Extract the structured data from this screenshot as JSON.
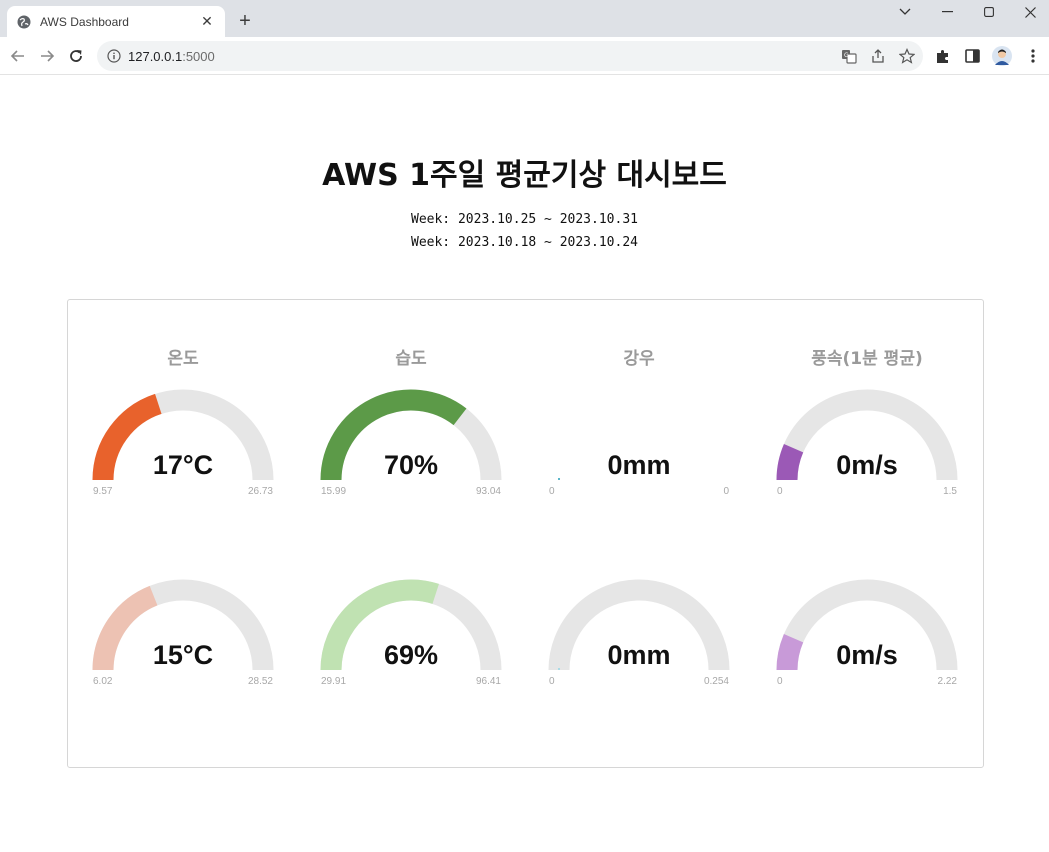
{
  "browser": {
    "tab_title": "AWS Dashboard",
    "url_host": "127.0.0.1",
    "url_rest": ":5000"
  },
  "page": {
    "title": "AWS 1주일 평균기상 대시보드",
    "weeks": [
      "Week: 2023.10.25 ~ 2023.10.31",
      "Week: 2023.10.18 ~ 2023.10.24"
    ]
  },
  "labels": [
    "온도",
    "습도",
    "강우",
    "풍속(1분 평균)"
  ],
  "gauges": [
    {
      "id": "temp-current",
      "row": 0,
      "col": 0,
      "value": "17°C",
      "num": 17,
      "min": "9.57",
      "max": "26.73",
      "minv": 9.57,
      "maxv": 26.73,
      "color": "#e8622c",
      "pct": 0.4
    },
    {
      "id": "humidity-current",
      "row": 0,
      "col": 1,
      "value": "70%",
      "num": 70,
      "min": "15.99",
      "max": "93.04",
      "minv": 15.99,
      "maxv": 93.04,
      "color": "#5c9a48",
      "pct": 0.71
    },
    {
      "id": "rain-current",
      "row": 0,
      "col": 2,
      "value": "0mm",
      "num": 0,
      "min": "0",
      "max": "0",
      "minv": 0,
      "maxv": 0,
      "color": "#59b6c9",
      "pct": 0.0,
      "no_track": true
    },
    {
      "id": "wind-current",
      "row": 0,
      "col": 3,
      "value": "0m/s",
      "num": 0,
      "min": "0",
      "max": "1.5",
      "minv": 0,
      "maxv": 1.5,
      "color": "#9b59b6",
      "pct": 0.13
    },
    {
      "id": "temp-previous",
      "row": 1,
      "col": 0,
      "value": "15°C",
      "num": 15,
      "min": "6.02",
      "max": "28.52",
      "minv": 6.02,
      "maxv": 28.52,
      "color": "#edc2b3",
      "pct": 0.38
    },
    {
      "id": "humidity-previous",
      "row": 1,
      "col": 1,
      "value": "69%",
      "num": 69,
      "min": "29.91",
      "max": "96.41",
      "minv": 29.91,
      "maxv": 96.41,
      "color": "#c0e2b2",
      "pct": 0.6
    },
    {
      "id": "rain-previous",
      "row": 1,
      "col": 2,
      "value": "0mm",
      "num": 0,
      "min": "0",
      "max": "0.254",
      "minv": 0,
      "maxv": 0.254,
      "color": "#a9dbe6",
      "pct": 0.0
    },
    {
      "id": "wind-previous",
      "row": 1,
      "col": 3,
      "value": "0m/s",
      "num": 0,
      "min": "0",
      "max": "2.22",
      "minv": 0,
      "maxv": 2.22,
      "color": "#c89ad8",
      "pct": 0.13
    }
  ],
  "colors": {
    "track": "#e6e6e6",
    "label": "#9a9a9a",
    "minmax": "#a8a8a8"
  }
}
